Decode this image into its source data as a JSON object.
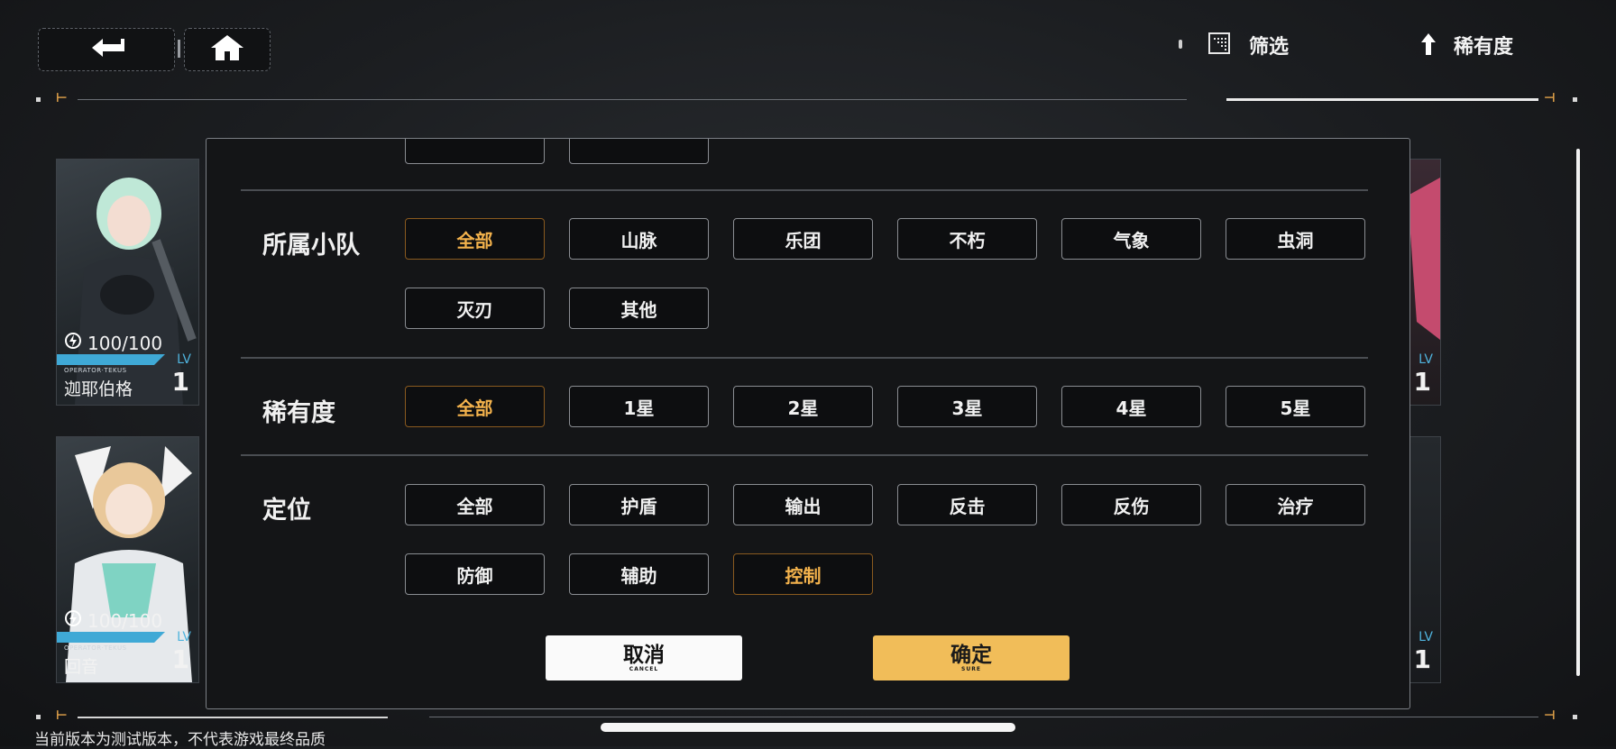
{
  "topbar": {
    "back_icon": "back-arrow-icon",
    "home_icon": "home-icon",
    "filter_label": "筛选",
    "sort_label": "稀有度"
  },
  "cards": [
    {
      "energy": "100/100",
      "operator": "OPERATOR·TEKUS",
      "name": "迦耶伯格",
      "lv_label": "LV",
      "level": "1"
    },
    {
      "energy": "100/100",
      "operator": "OPERATOR·TEKUS",
      "name": "回音",
      "lv_label": "LV",
      "level": "1"
    },
    {
      "lv_label": "LV",
      "level": "1"
    },
    {
      "lv_label": "LV",
      "level": "1"
    }
  ],
  "filter": {
    "squad": {
      "title": "所属小队",
      "options": [
        "全部",
        "山脉",
        "乐团",
        "不朽",
        "气象",
        "虫洞",
        "灭刃",
        "其他"
      ],
      "selected": "全部"
    },
    "rarity": {
      "title": "稀有度",
      "options": [
        "全部",
        "1星",
        "2星",
        "3星",
        "4星",
        "5星"
      ],
      "selected": "全部"
    },
    "position": {
      "title": "定位",
      "options": [
        "全部",
        "护盾",
        "输出",
        "反击",
        "反伤",
        "治疗",
        "防御",
        "辅助",
        "控制"
      ],
      "selected": "控制"
    },
    "cancel": {
      "label": "取消",
      "sub": "CANCEL"
    },
    "confirm": {
      "label": "确定",
      "sub": "SURE"
    }
  },
  "footer": {
    "notice": "当前版本为测试版本，不代表游戏最终品质"
  },
  "colors": {
    "accent": "#f3b24c",
    "confirm_bg": "#f1bd59",
    "level_blue": "#4fb3dd"
  }
}
